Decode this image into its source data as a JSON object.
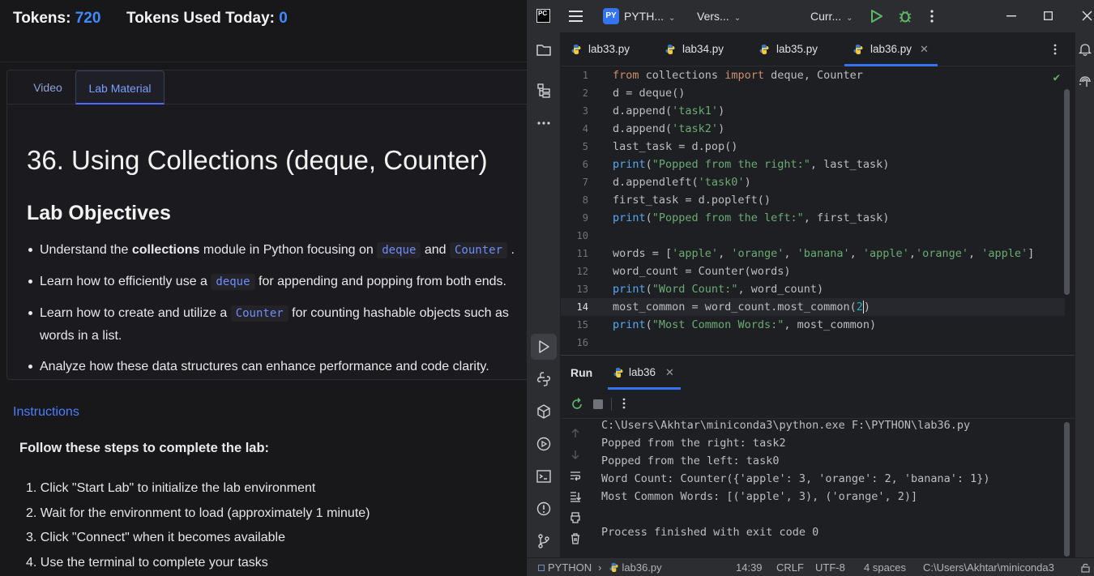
{
  "tokens": {
    "label": "Tokens:",
    "value": "720",
    "used_label": "Tokens Used Today:",
    "used_value": "0"
  },
  "lab_tabs": {
    "video": "Video",
    "lab": "Lab Material"
  },
  "lab": {
    "title": "36. Using Collections (deque, Counter)",
    "objectives_heading": "Lab Objectives",
    "obj1": {
      "a": "Understand the ",
      "b": "collections",
      "c": " module in Python focusing on ",
      "d": "deque",
      "e": " and ",
      "f": "Counter",
      "g": " ."
    },
    "obj2": {
      "a": "Learn how to efficiently use a ",
      "b": "deque",
      "c": " for appending and popping from both ends."
    },
    "obj3": {
      "a": "Learn how to create and utilize a ",
      "b": "Counter",
      "c": " for counting hashable objects such as words in a list."
    },
    "obj4": "Analyze how these data structures can enhance performance and code clarity."
  },
  "instructions": {
    "link": "Instructions",
    "lead": "Follow these steps to complete the lab:",
    "steps": [
      "1. Click \"Start Lab\" to initialize the lab environment",
      "2. Wait for the environment to load (approximately 1 minute)",
      "3. Click \"Connect\" when it becomes available",
      "4. Use the terminal to complete your tasks"
    ]
  },
  "ide": {
    "project_badge": "PY",
    "project": "PYTH...",
    "vcs": "Vers...",
    "run_config": "Curr...",
    "tabs": [
      "lab33.py",
      "lab34.py",
      "lab35.py",
      "lab36.py"
    ],
    "active_tab": "lab36.py",
    "line_numbers": [
      "1",
      "2",
      "3",
      "4",
      "5",
      "6",
      "7",
      "8",
      "9",
      "10",
      "11",
      "12",
      "13",
      "14",
      "15",
      "16"
    ],
    "code": {
      "l1_kw1": "from",
      "l1_a": " collections ",
      "l1_kw2": "import",
      "l1_b": " deque, Counter",
      "l2": "d = deque()",
      "l3_a": "d.append(",
      "l3_s": "'task1'",
      "l3_b": ")",
      "l4_a": "d.append(",
      "l4_s": "'task2'",
      "l4_b": ")",
      "l5": "last_task = d.pop()",
      "l6_f": "print",
      "l6_a": "(",
      "l6_s": "\"Popped from the right:\"",
      "l6_b": ", last_task)",
      "l7_a": "d.appendleft(",
      "l7_s": "'task0'",
      "l7_b": ")",
      "l8": "first_task = d.popleft()",
      "l9_f": "print",
      "l9_a": "(",
      "l9_s": "\"Popped from the left:\"",
      "l9_b": ", first_task)",
      "l11_a": "words = [",
      "l11_s1": "'apple'",
      "l11_c1": ", ",
      "l11_s2": "'orange'",
      "l11_c2": ", ",
      "l11_s3": "'banana'",
      "l11_c3": ", ",
      "l11_s4": "'apple'",
      "l11_c4": ",",
      "l11_s5": "'orange'",
      "l11_c5": ", ",
      "l11_s6": "'apple'",
      "l11_b": "]",
      "l12": "word_count = Counter(words)",
      "l13_f": "print",
      "l13_a": "(",
      "l13_s": "\"Word Count:\"",
      "l13_b": ", word_count)",
      "l14_a": "most_common = word_count.most_common(",
      "l14_n": "2",
      "l14_b": ")",
      "l15_f": "print",
      "l15_a": "(",
      "l15_s": "\"Most Common Words:\"",
      "l15_b": ", most_common)"
    },
    "run": {
      "label": "Run",
      "tab": "lab36",
      "output": [
        "C:\\Users\\Akhtar\\miniconda3\\python.exe F:\\PYTHON\\lab36.py",
        "Popped from the right: task2",
        "Popped from the left: task0",
        "Word Count: Counter({'apple': 3, 'orange': 2, 'banana': 1})",
        "Most Common Words: [('apple', 3), ('orange', 2)]",
        "",
        "Process finished with exit code 0"
      ]
    },
    "status": {
      "project": "PYTHON",
      "file": "lab36.py",
      "position": "14:39",
      "line_sep": "CRLF",
      "encoding": "UTF-8",
      "indent": "4 spaces",
      "interpreter": "C:\\Users\\Akhtar\\miniconda3"
    }
  }
}
